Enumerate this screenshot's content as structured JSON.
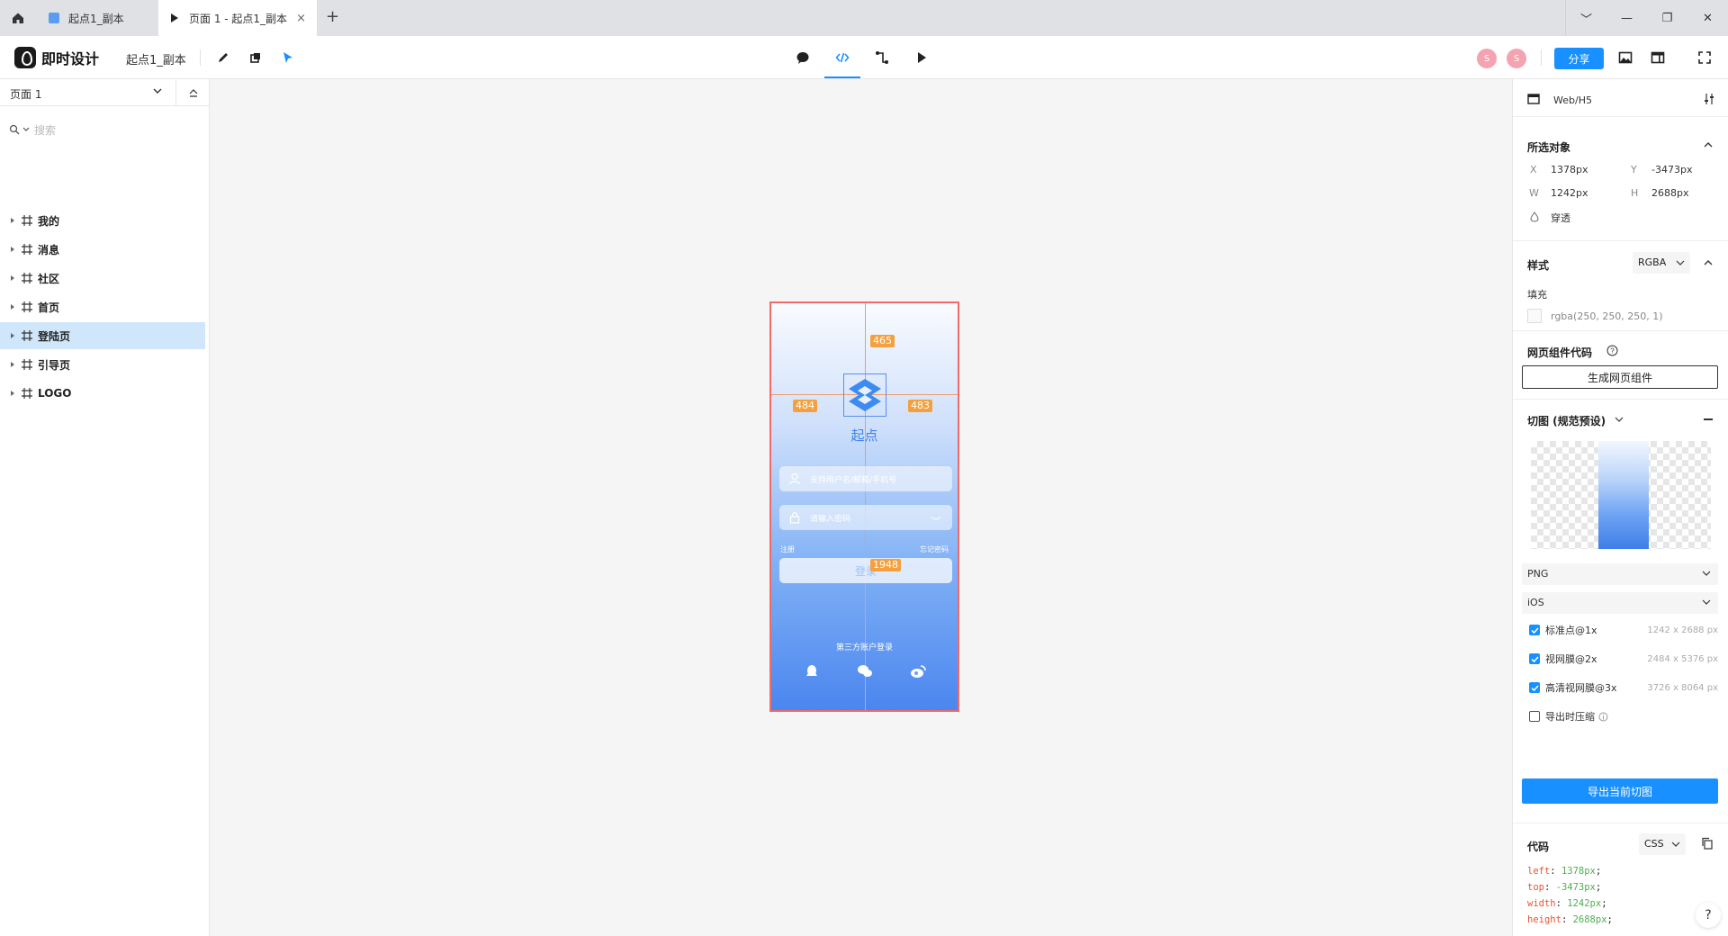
{
  "tabs": [
    {
      "label": "起点1_副本",
      "active": false
    },
    {
      "label": "页面 1 - 起点1_副本",
      "active": true
    }
  ],
  "tab_close": "×",
  "tab_add": "+",
  "window_controls": [
    "﹀",
    "—",
    "❐",
    "✕"
  ],
  "toolbar": {
    "app_name": "即时设计",
    "doc_name": "起点1_副本",
    "avatars": [
      "S",
      "S"
    ],
    "share_label": "分享"
  },
  "left_panel": {
    "page_select": "页面 1",
    "search_placeholder": "搜索",
    "layers": [
      {
        "label": "我的",
        "selected": false
      },
      {
        "label": "消息",
        "selected": false
      },
      {
        "label": "社区",
        "selected": false
      },
      {
        "label": "首页",
        "selected": false
      },
      {
        "label": "登陆页",
        "selected": true
      },
      {
        "label": "引导页",
        "selected": false
      },
      {
        "label": "LOGO",
        "selected": false
      }
    ]
  },
  "artboard": {
    "measure_top": "465",
    "measure_left": "484",
    "measure_right": "483",
    "measure_bottom": "1948",
    "app_name": "起点",
    "username_placeholder": "支持用户名/邮箱/手机号",
    "password_placeholder": "请输入密码",
    "register_label": "注册",
    "forgot_label": "忘记密码",
    "login_label": "登录",
    "third_party_label": "第三方账户登录"
  },
  "right_panel": {
    "device": "Web/H5",
    "selected_title": "所选对象",
    "x_key": "X",
    "x_val": "1378px",
    "y_key": "Y",
    "y_val": "-3473px",
    "w_key": "W",
    "w_val": "1242px",
    "h_key": "H",
    "h_val": "2688px",
    "pass_through": "穿透",
    "style_title": "样式",
    "color_mode": "RGBA",
    "fill_title": "填充",
    "fill_value": "rgba(250, 250, 250, 1)",
    "web_component_title": "网页组件代码",
    "generate_button": "生成网页组件",
    "slice_title": "切图 (规范预设)",
    "format": "PNG",
    "platform": "iOS",
    "exports": [
      {
        "label": "标准点@1x",
        "size": "1242 x 2688 px",
        "checked": true
      },
      {
        "label": "视网膜@2x",
        "size": "2484 x 5376 px",
        "checked": true
      },
      {
        "label": "高清视网膜@3x",
        "size": "3726 x 8064 px",
        "checked": true
      }
    ],
    "compress_label": "导出时压缩",
    "export_button": "导出当前切图",
    "code_title": "代码",
    "code_lang": "CSS",
    "code_lines": [
      {
        "key": "left",
        "val": "1378px"
      },
      {
        "key": "top",
        "val": "-3473px"
      },
      {
        "key": "width",
        "val": "1242px"
      },
      {
        "key": "height",
        "val": "2688px"
      }
    ],
    "help": "?"
  },
  "colors": {
    "accent": "#1890ff",
    "artboard_border": "#f06a6a",
    "measure": "#f5a03e",
    "selected_layer": "#cfe6fb"
  }
}
